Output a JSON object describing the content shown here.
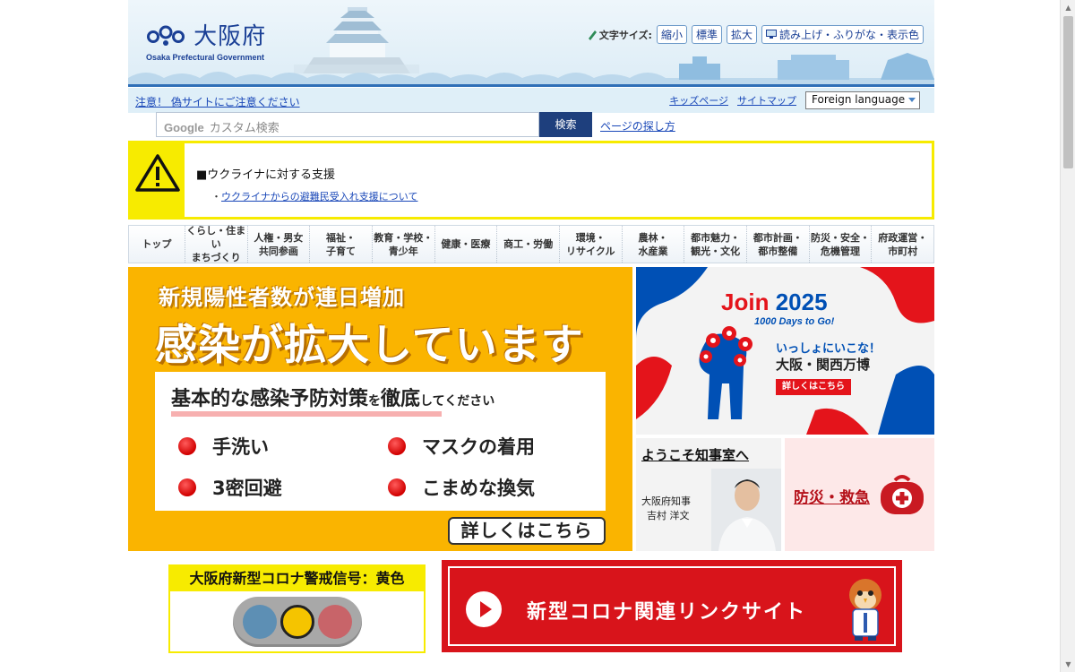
{
  "header": {
    "logo_title": "大阪府",
    "logo_subtitle": "Osaka Prefectural Government",
    "fontsize_label": "文字サイズ:",
    "fontsize_buttons": [
      "縮小",
      "標準",
      "拡大"
    ],
    "read_button": "読み上げ・ふりがな・表示色"
  },
  "util": {
    "warning_link": "注意！ 偽サイトにご注意ください",
    "kids_link": "キッズページ",
    "sitemap_link": "サイトマップ",
    "language_select": "Foreign language"
  },
  "search": {
    "google_label": "Google",
    "placeholder": "カスタム検索",
    "button": "検索",
    "howto_link": "ページの探し方"
  },
  "alert": {
    "title": "■ウクライナに対する支援",
    "link_prefix": "・",
    "link": "ウクライナからの避難民受入れ支援について"
  },
  "nav": {
    "items": [
      {
        "l1": "トップ",
        "l2": ""
      },
      {
        "l1": "くらし・住まい",
        "l2": "まちづくり"
      },
      {
        "l1": "人権・男女",
        "l2": "共同参画"
      },
      {
        "l1": "福祉・",
        "l2": "子育て"
      },
      {
        "l1": "教育・学校・",
        "l2": "青少年"
      },
      {
        "l1": "健康・医療",
        "l2": ""
      },
      {
        "l1": "商工・労働",
        "l2": ""
      },
      {
        "l1": "環境・",
        "l2": "リサイクル"
      },
      {
        "l1": "農林・",
        "l2": "水産業"
      },
      {
        "l1": "都市魅力・",
        "l2": "観光・文化"
      },
      {
        "l1": "都市計画・",
        "l2": "都市整備"
      },
      {
        "l1": "防災・安全・",
        "l2": "危機管理"
      },
      {
        "l1": "府政運営・",
        "l2": "市町村"
      }
    ]
  },
  "covid_banner": {
    "subtitle": "新規陽性者数が連日増加",
    "title": "感染が拡大しています",
    "panel_head": "基本的な感染予防対策",
    "panel_head_small1": "を",
    "panel_head_mid": "徹底",
    "panel_head_small2": "してください",
    "measures": [
      "手洗い",
      "マスクの着用",
      "3密回避",
      "こまめな換気"
    ],
    "more_button": "詳しくはこちら"
  },
  "expo": {
    "join": "Join",
    "year": "2025",
    "days": "1000 Days to Go!",
    "lets_go": "いっしょにいこな！",
    "name": "大阪・関西万博",
    "button": "詳しくはこちら"
  },
  "governor": {
    "title": "ようこそ知事室へ",
    "role": "大阪府知事",
    "name": "吉村 洋文"
  },
  "disaster": {
    "label": "防災・救急"
  },
  "signal": {
    "title": "大阪府新型コロナ警戒信号：黄色",
    "active_light": "yellow"
  },
  "corona_link": {
    "label": "新型コロナ関連リンクサイト"
  },
  "colors": {
    "brand_blue": "#1a3f95",
    "alert_yellow": "#f7eb00",
    "banner_orange": "#fab400",
    "link_red": "#d8141b"
  }
}
